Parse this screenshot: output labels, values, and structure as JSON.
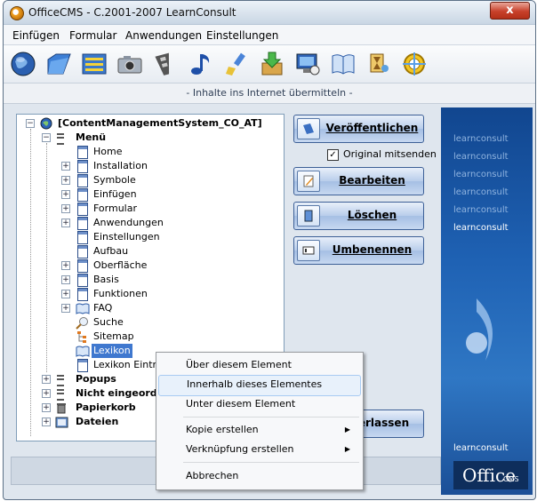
{
  "window": {
    "title": "OfficeCMS - C.2001-2007 LearnConsult",
    "close_glyph": "x"
  },
  "menubar": [
    "Einfügen",
    "Formular",
    "Anwendungen",
    "Einstellungen"
  ],
  "toolbar": {
    "icons": [
      "globe-icon",
      "folder-icon",
      "list-icon",
      "camera-icon",
      "film-icon",
      "music-note-icon",
      "brush-icon",
      "download-box-icon",
      "monitor-icon",
      "book-icon",
      "hourglass-icon",
      "crosshair-icon"
    ]
  },
  "statusline": "- Inhalte ins Internet übermitteln -",
  "tree": {
    "root": "[ContentManagementSystem_CO_AT]",
    "menu": "Menü",
    "items": [
      "Home",
      "Installation",
      "Symbole",
      "Einfügen",
      "Formular",
      "Anwendungen",
      "Einstellungen",
      "Aufbau",
      "Oberfläche",
      "Basis",
      "Funktionen",
      "FAQ",
      "Suche",
      "Sitemap",
      "Lexikon",
      "Lexikon Eintrag"
    ],
    "popups": "Popups",
    "nicht": "Nicht eingeordnet",
    "papierkorb": "Papierkorb",
    "dateien": "Dateien"
  },
  "buttons": {
    "publish": "Veröffentlichen",
    "original_checkbox": "Original mitsenden",
    "edit": "Bearbeiten",
    "delete": "Löschen",
    "rename": "Umbenennen",
    "leave_partial": "erlassen"
  },
  "context_menu": {
    "items": [
      "Über diesem Element",
      "Innerhalb dieses Elementes",
      "Unter diesem Element",
      "Kopie erstellen",
      "Verknüpfung erstellen",
      "Abbrechen"
    ],
    "submenu_arrow": "▶"
  },
  "banner": {
    "brand": "learnconsult",
    "logo": "Office",
    "logo_sub": "CMS"
  },
  "colors": {
    "accent": "#2f6fc0",
    "banner": "#1f62b4",
    "highlight": "#e8f1fb"
  }
}
